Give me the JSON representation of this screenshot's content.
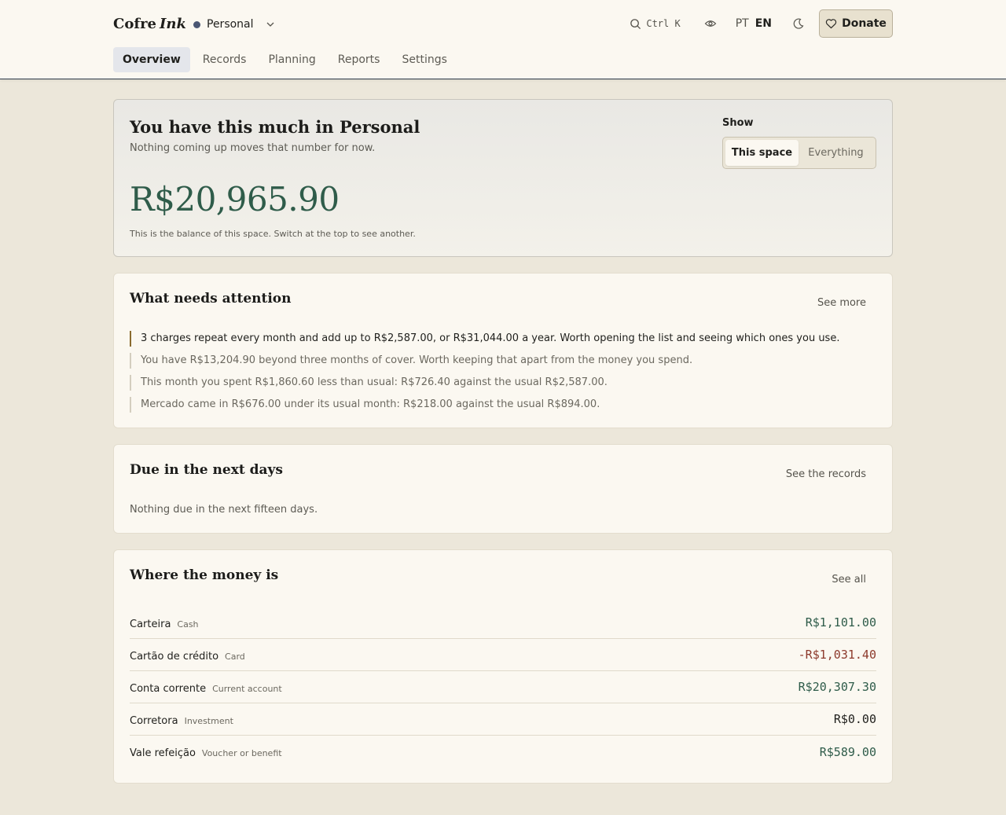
{
  "app": {
    "brand_main": "Cofre",
    "brand_accent": "Ink"
  },
  "space": {
    "name": "Personal",
    "dot_color": "#4a5673"
  },
  "header": {
    "search_shortcut": "Ctrl K",
    "lang_pt": "PT",
    "lang_en": "EN",
    "donate_label": "Donate"
  },
  "tabs": [
    {
      "label": "Overview",
      "active": true
    },
    {
      "label": "Records",
      "active": false
    },
    {
      "label": "Planning",
      "active": false
    },
    {
      "label": "Reports",
      "active": false
    },
    {
      "label": "Settings",
      "active": false
    }
  ],
  "hero": {
    "title": "You have this much in Personal",
    "subtitle": "Nothing coming up moves that number for now.",
    "balance": "R$20,965.90",
    "hint": "This is the balance of this space. Switch at the top to see another.",
    "show_label": "Show",
    "options": [
      "This space",
      "Everything"
    ]
  },
  "attention": {
    "title": "What needs attention",
    "link": "See more",
    "items": [
      "3 charges repeat every month and add up to R$2,587.00, or R$31,044.00 a year. Worth opening the list and seeing which ones you use.",
      "You have R$13,204.90 beyond three months of cover. Worth keeping that apart from the money you spend.",
      "This month you spent R$1,860.60 less than usual: R$726.40 against the usual R$2,587.00.",
      "Mercado came in R$676.00 under its usual month: R$218.00 against the usual R$894.00."
    ]
  },
  "due": {
    "title": "Due in the next days",
    "link": "See the records",
    "empty": "Nothing due in the next fifteen days."
  },
  "money": {
    "title": "Where the money is",
    "link": "See all",
    "accounts": [
      {
        "name": "Carteira",
        "kind": "Cash",
        "amount": "R$1,101.00",
        "tone": "pos"
      },
      {
        "name": "Cartão de crédito",
        "kind": "Card",
        "amount": "-R$1,031.40",
        "tone": "neg"
      },
      {
        "name": "Conta corrente",
        "kind": "Current account",
        "amount": "R$20,307.30",
        "tone": "pos"
      },
      {
        "name": "Corretora",
        "kind": "Investment",
        "amount": "R$0.00",
        "tone": "zero"
      },
      {
        "name": "Vale refeição",
        "kind": "Voucher or benefit",
        "amount": "R$589.00",
        "tone": "pos"
      }
    ]
  },
  "colors": {
    "accent_green": "#2f5c4a",
    "negative_red": "#8d3a2c",
    "highlight_bar": "#8a6a2e"
  }
}
